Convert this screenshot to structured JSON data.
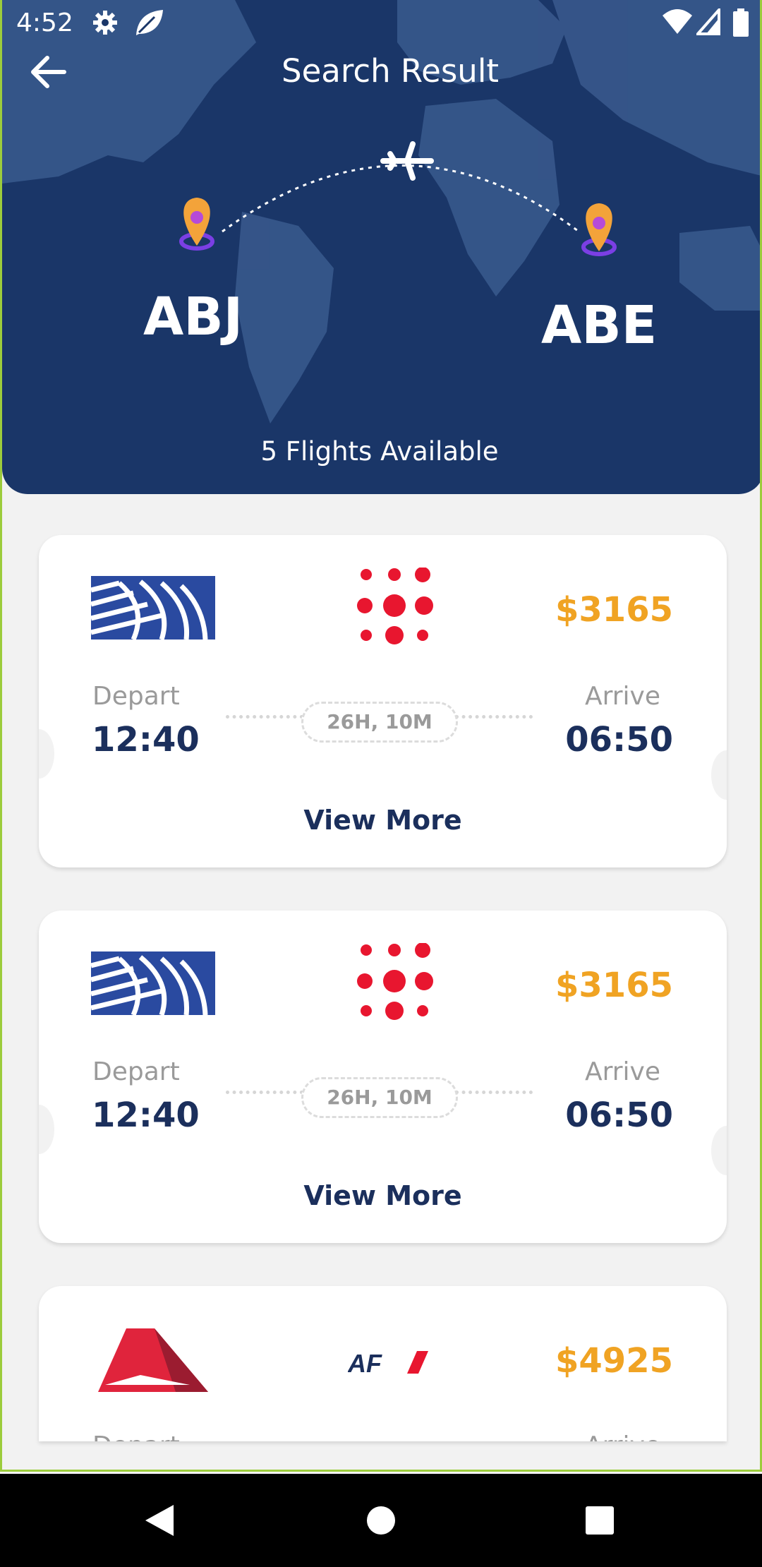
{
  "status": {
    "time": "4:52",
    "icons": [
      "settings-gear-icon",
      "leaf-icon",
      "wifi-icon",
      "signal-icon",
      "battery-icon"
    ]
  },
  "header": {
    "title": "Search Result",
    "origin": "ABJ",
    "destination": "ABE",
    "available": "5 Flights Available"
  },
  "colors": {
    "header_bg": "#1a3668",
    "price": "#f0a323",
    "time_text": "#1b2f5c",
    "frame_border": "#9ccc3c"
  },
  "flights": [
    {
      "airline_logo": "united-globe-logo",
      "partner_logo": "red-dots-logo",
      "price": "$3165",
      "depart_label": "Depart",
      "depart_time": "12:40",
      "duration": "26H, 10M",
      "arrive_label": "Arrive",
      "arrive_time": "06:50",
      "view_more": "View More"
    },
    {
      "airline_logo": "united-globe-logo",
      "partner_logo": "red-dots-logo",
      "price": "$3165",
      "depart_label": "Depart",
      "depart_time": "12:40",
      "duration": "26H, 10M",
      "arrive_label": "Arrive",
      "arrive_time": "06:50",
      "view_more": "View More"
    },
    {
      "airline_logo": "delta-triangle-logo",
      "partner_logo": "air-france-logo",
      "partner_text": "AF",
      "price": "$4925",
      "depart_label": "Depart",
      "arrive_label": "Arrive"
    }
  ],
  "navbar": {
    "buttons": [
      "back-triangle-icon",
      "home-circle-icon",
      "recents-square-icon"
    ]
  }
}
